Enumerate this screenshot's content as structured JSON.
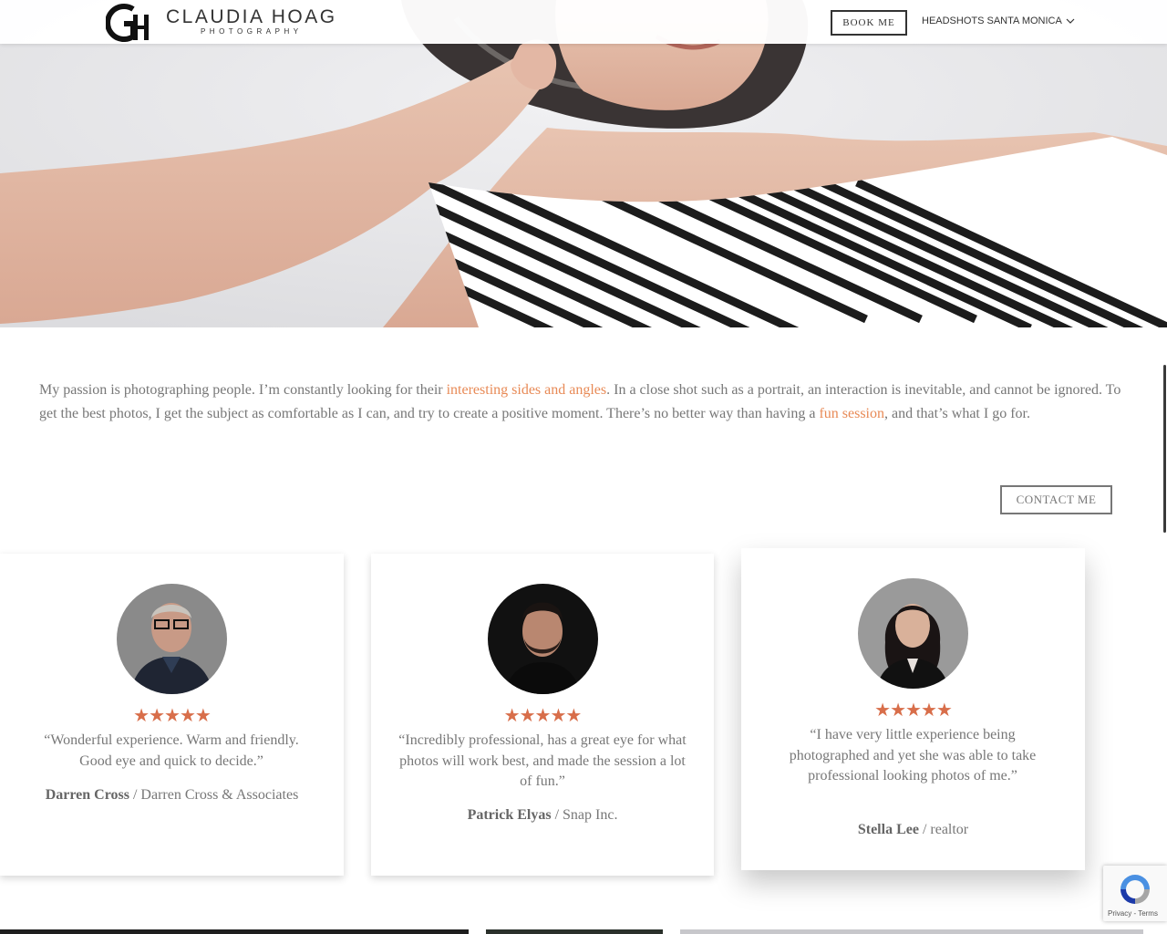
{
  "header": {
    "logo_name": "CLAUDIA HOAG",
    "logo_sub": "PHOTOGRAPHY",
    "book_label": "BOOK ME",
    "nav_location": "HEADSHOTS SANTA MONICA"
  },
  "intro": {
    "p1_a": "My passion is photographing people. I’m constantly looking for their ",
    "p1_link": "interesting sides and angles",
    "p1_b": ". In a close shot such as a portrait, an interaction is inevitable, and cannot be ignored. To get the best photos, I get the subject as comfortable as I can, and try to create a positive moment. There’s no better way than having a ",
    "p1_link2": "fun session",
    "p1_c": ", and that’s what I go for.",
    "contact_label": "CONTACT ME"
  },
  "testimonials": [
    {
      "rating": 5,
      "stars": "★★★★★",
      "quote": "“Wonderful experience. Warm and friendly. Good eye and quick to decide.”",
      "name": "Darren Cross",
      "company": " / Darren Cross & Associates"
    },
    {
      "rating": 5,
      "stars": "★★★★★",
      "quote": "“Incredibly professional, has a great eye for what photos will work best, and made the session a lot of fun.”",
      "name": "Patrick Elyas",
      "company": " / Snap Inc."
    },
    {
      "rating": 5,
      "stars": "★★★★★",
      "quote": "“I have very little experience being photographed and yet she was able to take professional looking photos of me.”",
      "name": "Stella Lee",
      "company": " / realtor"
    }
  ],
  "recaptcha": {
    "terms": "Privacy - Terms"
  },
  "colors": {
    "accent": "#e88a56",
    "star": "#d86e4a",
    "text": "#777777"
  }
}
